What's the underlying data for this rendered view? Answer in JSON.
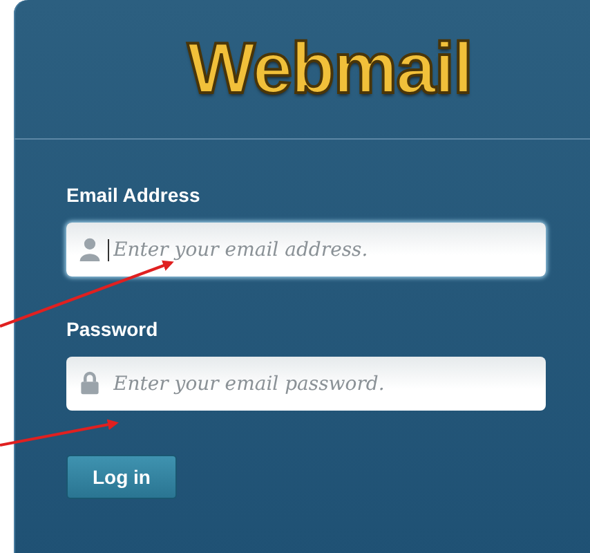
{
  "logo": {
    "text": "Webmail"
  },
  "fields": [
    {
      "label": "Email Address",
      "kind": "user",
      "placeholder": "Enter your email address.",
      "focused": true
    },
    {
      "label": "Password",
      "kind": "lock",
      "placeholder": "Enter your email password.",
      "focused": false
    }
  ],
  "button": {
    "label": "Log in"
  }
}
